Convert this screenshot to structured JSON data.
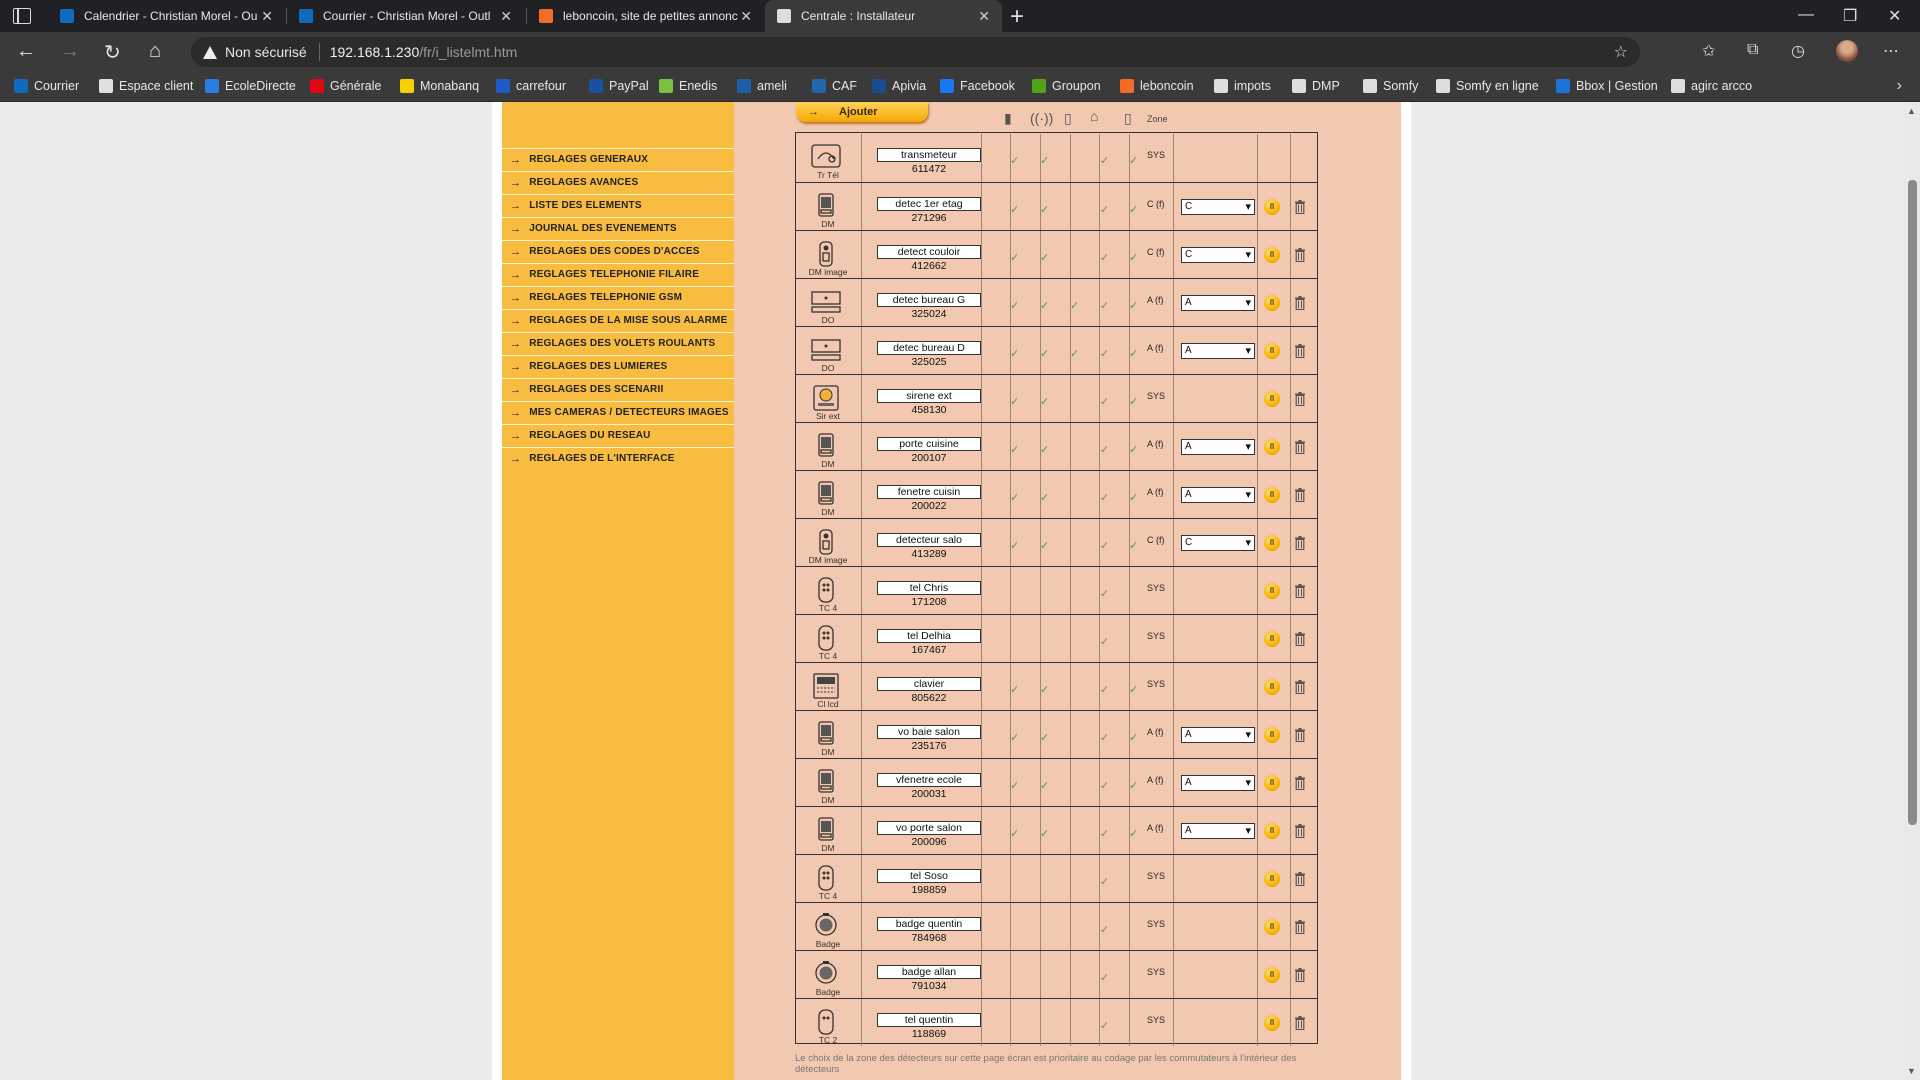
{
  "browser": {
    "tabs": [
      {
        "title": "Calendrier - Christian Morel - Ou",
        "color": "#0f6cbd",
        "active": false
      },
      {
        "title": "Courrier - Christian Morel - Outl",
        "color": "#0f6cbd",
        "active": false
      },
      {
        "title": "leboncoin, site de petites annonc",
        "color": "#f56b2a",
        "active": false
      },
      {
        "title": "Centrale : Installateur",
        "color": "#dddddd",
        "active": true
      }
    ],
    "address": {
      "security_label": "Non sécurisé",
      "host": "192.168.1.230",
      "path": "/fr/i_listelmt.htm"
    },
    "bookmarks": [
      {
        "label": "Courrier",
        "color": "#0f6cbd"
      },
      {
        "label": "Espace client",
        "color": "#e0e0e0"
      },
      {
        "label": "EcoleDirecte",
        "color": "#2a7de1"
      },
      {
        "label": "Générale",
        "color": "#e30613"
      },
      {
        "label": "Monabanq",
        "color": "#f7d000"
      },
      {
        "label": "carrefour",
        "color": "#1e5bc6"
      },
      {
        "label": "PayPal",
        "color": "#1b4fa0"
      },
      {
        "label": "Enedis",
        "color": "#7ac143"
      },
      {
        "label": "ameli",
        "color": "#1f5fa8"
      },
      {
        "label": "CAF",
        "color": "#2266b0"
      },
      {
        "label": "Apivia",
        "color": "#1a4d8c"
      },
      {
        "label": "Facebook",
        "color": "#1877f2"
      },
      {
        "label": "Groupon",
        "color": "#53a318"
      },
      {
        "label": "leboncoin",
        "color": "#f56b2a"
      },
      {
        "label": "impots",
        "color": "#dddddd"
      },
      {
        "label": "DMP",
        "color": "#dddddd"
      },
      {
        "label": "Somfy",
        "color": "#dddddd"
      },
      {
        "label": "Somfy en ligne",
        "color": "#dddddd"
      },
      {
        "label": "Bbox | Gestion",
        "color": "#1d74d8"
      },
      {
        "label": "agirc arcco",
        "color": "#dddddd"
      }
    ]
  },
  "sidebar": {
    "items": [
      "REGLAGES GENERAUX",
      "REGLAGES AVANCES",
      "LISTE DES ELEMENTS",
      "JOURNAL DES EVENEMENTS",
      "REGLAGES DES CODES D'ACCES",
      "REGLAGES TELEPHONIE FILAIRE",
      "REGLAGES TELEPHONIE GSM",
      "REGLAGES DE LA MISE SOUS ALARME",
      "REGLAGES DES VOLETS ROULANTS",
      "REGLAGES DES LUMIERES",
      "REGLAGES DES SCENARII",
      "MES CAMERAS / DETECTEURS IMAGES",
      "REGLAGES DU RESEAU",
      "REGLAGES DE L'INTERFACE"
    ]
  },
  "main": {
    "add_label": "Ajouter",
    "zone_header": "Zone",
    "check_glyph": "✓",
    "pause_glyph": "II",
    "footnote": "Le choix de la zone des détecteurs sur cette page écran est prioritaire au codage par les commutateurs à l'intérieur des détecteurs",
    "devices": [
      {
        "type": "Tr Tél",
        "icon": "phone",
        "name": "transmeteur",
        "id": "611472",
        "checks": [
          1,
          1,
          0,
          1,
          1
        ],
        "zone_text": "SYS",
        "zone_select": "",
        "pause": false,
        "trash": false
      },
      {
        "type": "DM",
        "icon": "dm",
        "name": "detec 1er etag",
        "id": "271296",
        "checks": [
          1,
          1,
          0,
          1,
          1
        ],
        "zone_text": "C (f)",
        "zone_select": "C",
        "pause": true,
        "trash": true
      },
      {
        "type": "DM image",
        "icon": "dm-image",
        "name": "detect couloir",
        "id": "412662",
        "checks": [
          1,
          1,
          0,
          1,
          1
        ],
        "zone_text": "C (f)",
        "zone_select": "C",
        "pause": true,
        "trash": true
      },
      {
        "type": "DO",
        "icon": "do",
        "name": "detec bureau G",
        "id": "325024",
        "checks": [
          1,
          1,
          1,
          1,
          1
        ],
        "zone_text": "A (f)",
        "zone_select": "A",
        "pause": true,
        "trash": true
      },
      {
        "type": "DO",
        "icon": "do",
        "name": "detec bureau D",
        "id": "325025",
        "checks": [
          1,
          1,
          1,
          1,
          1
        ],
        "zone_text": "A (f)",
        "zone_select": "A",
        "pause": true,
        "trash": true
      },
      {
        "type": "Sir ext",
        "icon": "siren",
        "name": "sirene ext",
        "id": "458130",
        "checks": [
          1,
          1,
          0,
          1,
          1
        ],
        "zone_text": "SYS",
        "zone_select": "",
        "pause": true,
        "trash": true
      },
      {
        "type": "DM",
        "icon": "dm",
        "name": "porte cuisine",
        "id": "200107",
        "checks": [
          1,
          1,
          0,
          1,
          1
        ],
        "zone_text": "A (f)",
        "zone_select": "A",
        "pause": true,
        "trash": true
      },
      {
        "type": "DM",
        "icon": "dm",
        "name": "fenetre cuisin",
        "id": "200022",
        "checks": [
          1,
          1,
          0,
          1,
          1
        ],
        "zone_text": "A (f)",
        "zone_select": "A",
        "pause": true,
        "trash": true
      },
      {
        "type": "DM image",
        "icon": "dm-image",
        "name": "detecteur salo",
        "id": "413289",
        "checks": [
          1,
          1,
          0,
          1,
          1
        ],
        "zone_text": "C (f)",
        "zone_select": "C",
        "pause": true,
        "trash": true
      },
      {
        "type": "TC 4",
        "icon": "remote",
        "name": "tel Chris",
        "id": "171208",
        "checks": [
          0,
          0,
          0,
          1,
          0
        ],
        "zone_text": "SYS",
        "zone_select": "",
        "pause": true,
        "trash": true
      },
      {
        "type": "TC 4",
        "icon": "remote",
        "name": "tel Delhia",
        "id": "167467",
        "checks": [
          0,
          0,
          0,
          1,
          0
        ],
        "zone_text": "SYS",
        "zone_select": "",
        "pause": true,
        "trash": true
      },
      {
        "type": "Cl lcd",
        "icon": "keypad",
        "name": "clavier",
        "id": "805622",
        "checks": [
          1,
          1,
          0,
          1,
          1
        ],
        "zone_text": "SYS",
        "zone_select": "",
        "pause": true,
        "trash": true
      },
      {
        "type": "DM",
        "icon": "dm",
        "name": "vo baie salon",
        "id": "235176",
        "checks": [
          1,
          1,
          0,
          1,
          1
        ],
        "zone_text": "A (f)",
        "zone_select": "A",
        "pause": true,
        "trash": true
      },
      {
        "type": "DM",
        "icon": "dm",
        "name": "vfenetre ecole",
        "id": "200031",
        "checks": [
          1,
          1,
          0,
          1,
          1
        ],
        "zone_text": "A (f)",
        "zone_select": "A",
        "pause": true,
        "trash": true
      },
      {
        "type": "DM",
        "icon": "dm",
        "name": "vo porte salon",
        "id": "200096",
        "checks": [
          1,
          1,
          0,
          1,
          1
        ],
        "zone_text": "A (f)",
        "zone_select": "A",
        "pause": true,
        "trash": true
      },
      {
        "type": "TC 4",
        "icon": "remote",
        "name": "tel Soso",
        "id": "198859",
        "checks": [
          0,
          0,
          0,
          1,
          0
        ],
        "zone_text": "SYS",
        "zone_select": "",
        "pause": true,
        "trash": true
      },
      {
        "type": "Badge",
        "icon": "badge",
        "name": "badge quentin",
        "id": "784968",
        "checks": [
          0,
          0,
          0,
          1,
          0
        ],
        "zone_text": "SYS",
        "zone_select": "",
        "pause": true,
        "trash": true
      },
      {
        "type": "Badge",
        "icon": "badge",
        "name": "badge allan",
        "id": "791034",
        "checks": [
          0,
          0,
          0,
          1,
          0
        ],
        "zone_text": "SYS",
        "zone_select": "",
        "pause": true,
        "trash": true
      },
      {
        "type": "TC 2",
        "icon": "remote2",
        "name": "tel quentin",
        "id": "118869",
        "checks": [
          0,
          0,
          0,
          1,
          0
        ],
        "zone_text": "SYS",
        "zone_select": "",
        "pause": true,
        "trash": true
      }
    ]
  }
}
